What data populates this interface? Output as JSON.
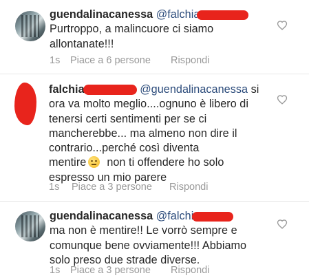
{
  "comments": [
    {
      "username": "guendalinacanessa",
      "mention": "@falchia",
      "text": "Purtroppo, a malincuore ci siamo allontanate!!!",
      "line1": "Purtroppo, a malincuore ci siamo",
      "line2": "allontanate!!!",
      "time": "1s",
      "likes": "Piace a 6 persone",
      "reply": "Rispondi"
    },
    {
      "username": "falchia",
      "mention": "@guendalinacanessa",
      "after_mention": "si",
      "line1": "ora va molto meglio....ognuno è libero di",
      "line2": "tenersi certi sentimenti per se ci",
      "line3": "mancherebbe... ma almeno non dire il",
      "line4": "contrario...perché così diventa",
      "line5a": "mentire",
      "line5b": "non ti offendere ho solo",
      "line6": "espresso un mio parere",
      "emoji": "neutral-face-emoji",
      "time": "1s",
      "likes": "Piace a 3 persone",
      "reply": "Rispondi"
    },
    {
      "username": "guendalinacanessa",
      "mention": "@falchi",
      "line1": "ma non è mentire!! Le vorrò sempre e",
      "line2": "comunque bene ovviamente!!! Abbiamo",
      "line3": "solo preso due strade diverse.",
      "time": "1s",
      "likes": "Piace a 3 persone",
      "reply": "Rispondi"
    }
  ],
  "colors": {
    "redaction": "#e8241c",
    "meta_text": "#999999",
    "mention": "#2a4a7a"
  },
  "icons": {
    "like": "heart-outline-icon"
  }
}
